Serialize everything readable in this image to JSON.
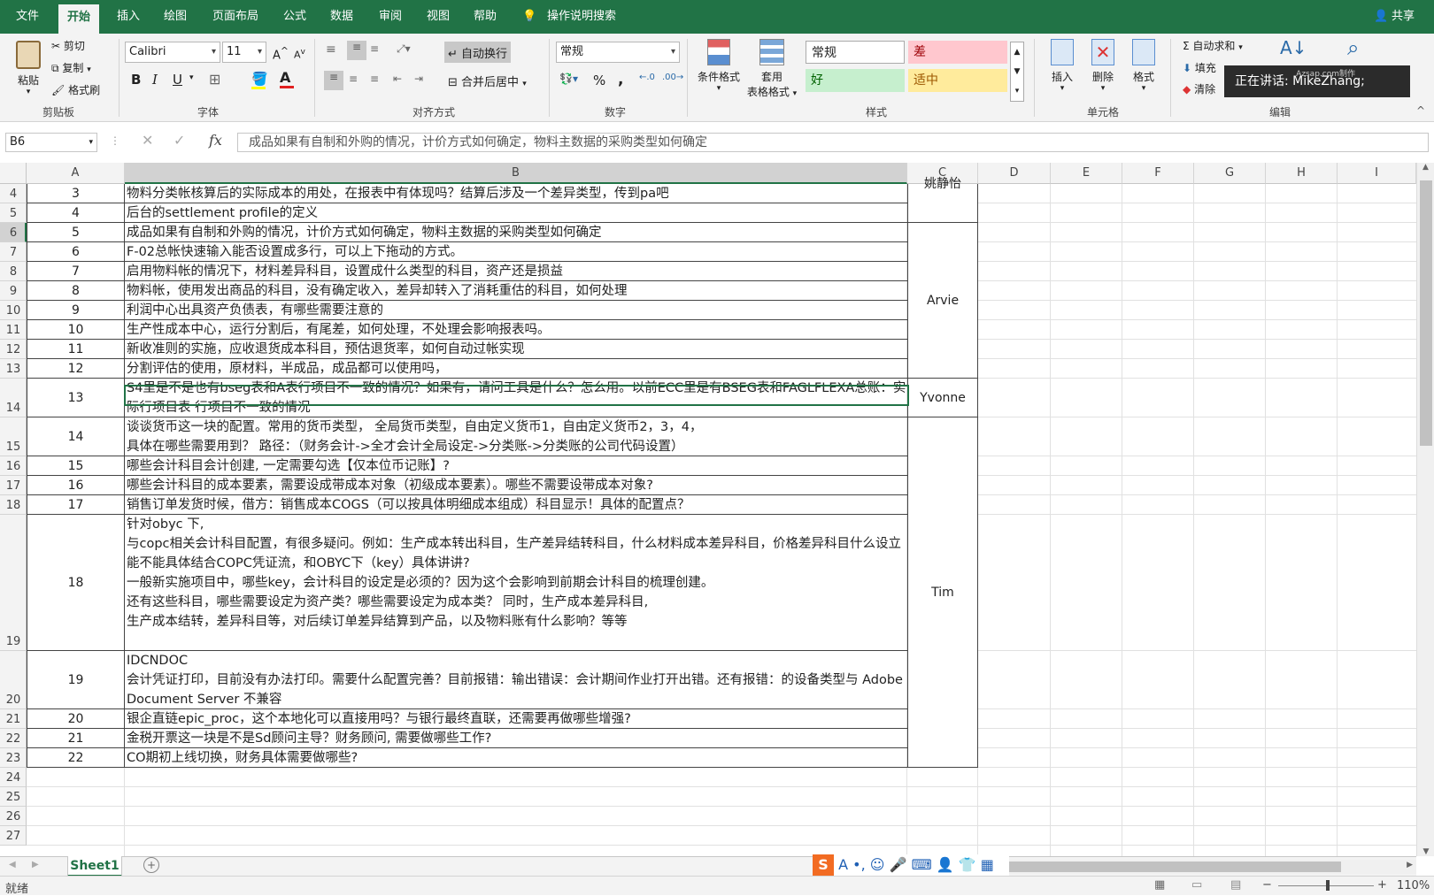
{
  "menu": {
    "file": "文件",
    "home": "开始",
    "insert": "插入",
    "draw": "绘图",
    "layout": "页面布局",
    "formulas": "公式",
    "data": "数据",
    "review": "审阅",
    "view": "视图",
    "help": "帮助",
    "tell_me": "操作说明搜索",
    "share": "共享"
  },
  "ribbon": {
    "clipboard": {
      "paste": "粘贴",
      "cut": "剪切",
      "copy": "复制",
      "format_painter": "格式刷",
      "label": "剪贴板"
    },
    "font": {
      "name": "Calibri",
      "size": "11",
      "bold": "B",
      "italic": "I",
      "underline": "U",
      "label": "字体"
    },
    "alignment": {
      "wrap_text": "自动换行",
      "merge_center": "合并后居中",
      "label": "对齐方式"
    },
    "number": {
      "format": "常规",
      "percent": "%",
      "comma": ",",
      "label": "数字"
    },
    "styles": {
      "conditional": "条件格式",
      "table_format_1": "套用",
      "table_format_2": "表格格式",
      "normal": "常规",
      "bad": "差",
      "good": "好",
      "neutral": "适中",
      "label": "样式"
    },
    "cells": {
      "insert": "插入",
      "delete": "删除",
      "format": "格式",
      "label": "单元格"
    },
    "editing": {
      "autosum": "自动求和",
      "fill": "填充",
      "clear": "清除",
      "label": "编辑"
    }
  },
  "tooltip": {
    "text": "正在讲话: MikeZhang;",
    "watermark": "Azsap.com制作"
  },
  "formula_bar": {
    "name_box": "B6",
    "fx": "fx",
    "content": "成品如果有自制和外购的情况，计价方式如何确定，物料主数据的采购类型如何确定"
  },
  "columns": [
    "A",
    "B",
    "C",
    "D",
    "E",
    "F",
    "G",
    "H",
    "I"
  ],
  "rows": [
    {
      "row": "4",
      "a": "3",
      "b": "物料分类帐核算后的实际成本的用处，在报表中有体现吗？结算后涉及一个差异类型，传到pa吧"
    },
    {
      "row": "5",
      "a": "4",
      "b": "后台的settlement profile的定义"
    },
    {
      "row": "6",
      "a": "5",
      "b": "成品如果有自制和外购的情况，计价方式如何确定，物料主数据的采购类型如何确定"
    },
    {
      "row": "7",
      "a": "6",
      "b": "F-02总帐快速输入能否设置成多行，可以上下拖动的方式。"
    },
    {
      "row": "8",
      "a": "7",
      "b": "启用物料帐的情况下，材料差异科目，设置成什么类型的科目，资产还是损益"
    },
    {
      "row": "9",
      "a": "8",
      "b": "物料帐，使用发出商品的科目，没有确定收入，差异却转入了消耗重估的科目，如何处理"
    },
    {
      "row": "10",
      "a": "9",
      "b": "利润中心出具资产负债表，有哪些需要注意的"
    },
    {
      "row": "11",
      "a": "10",
      "b": "生产性成本中心，运行分割后，有尾差，如何处理，不处理会影响报表吗。"
    },
    {
      "row": "12",
      "a": "11",
      "b": "新收准则的实施，应收退货成本科目，预估退货率，如何自动过帐实现"
    },
    {
      "row": "13",
      "a": "12",
      "b": "分割评估的使用，原材料，半成品，成品都可以使用吗，"
    },
    {
      "row": "14",
      "a": "13",
      "b": "S4里是不是也有bseg表和A表行项目不一致的情况？如果有，请问工具是什么？怎么用。以前ECC里是有BSEG表和FAGLFLEXA总账：实际行项目表 行项目不一致的情况"
    },
    {
      "row": "15",
      "a": "14",
      "b": "谈谈货币这一块的配置。常用的货币类型， 全局货币类型，自由定义货币1，自由定义货币2，3，4，\n具体在哪些需要用到？ 路径：（财务会计->全才会计全局设定->分类账->分类账的公司代码设置）"
    },
    {
      "row": "16",
      "a": "15",
      "b": "哪些会计科目会计创建, 一定需要勾选【仅本位币记账】?"
    },
    {
      "row": "17",
      "a": "16",
      "b": "哪些会计科目的成本要素，需要设成带成本对象（初级成本要素）。哪些不需要设带成本对象?"
    },
    {
      "row": "18",
      "a": "17",
      "b": "销售订单发货时候，借方：销售成本COGS（可以按具体明细成本组成）科目显示！具体的配置点？"
    },
    {
      "row": "19",
      "a": "18",
      "b": "针对obyc 下,\n与copc相关会计科目配置，有很多疑问。例如：生产成本转出科目，生产差异结转科目，什么材料成本差异科目，价格差异科目什么设立\n能不能具体结合COPC凭证流，和OBYC下（key）具体讲讲?\n一般新实施项目中，哪些key，会计科目的设定是必须的？因为这个会影响到前期会计科目的梳理创建。\n还有这些科目，哪些需要设定为资产类？哪些需要设定为成本类？ 同时，生产成本差异科目,\n生产成本结转，差异科目等，对后续订单差异结算到产品，以及物料账有什么影响？等等"
    },
    {
      "row": "20",
      "a": "19",
      "b": "IDCNDOC\n会计凭证打印，目前没有办法打印。需要什么配置完善？目前报错：输出错误：会计期间作业打开出错。还有报错：的设备类型与 Adobe Document Server 不兼容"
    },
    {
      "row": "21",
      "a": "20",
      "b": "银企直链epic_proc，这个本地化可以直接用吗？与银行最终直联，还需要再做哪些增强?"
    },
    {
      "row": "22",
      "a": "21",
      "b": "金税开票这一块是不是Sd顾问主导？财务顾问, 需要做哪些工作?"
    },
    {
      "row": "23",
      "a": "22",
      "b": "CO期初上线切换，财务具体需要做哪些?"
    },
    {
      "row": "24",
      "a": "",
      "b": ""
    },
    {
      "row": "25",
      "a": "",
      "b": ""
    },
    {
      "row": "26",
      "a": "",
      "b": ""
    },
    {
      "row": "27",
      "a": "",
      "b": ""
    }
  ],
  "column_c": [
    {
      "text": "姚静怡"
    },
    {
      "text": "Arvie"
    },
    {
      "text": "Yvonne"
    },
    {
      "text": "Tim"
    }
  ],
  "sheet": {
    "name": "Sheet1",
    "add": "+"
  },
  "status": {
    "ready": "就绪",
    "zoom": "110%",
    "minus": "−",
    "plus": "+"
  },
  "colors": {
    "accent": "#217346",
    "bad_bg": "#ffc7ce",
    "good_bg": "#c6efce",
    "neutral_bg": "#ffeb9c"
  }
}
